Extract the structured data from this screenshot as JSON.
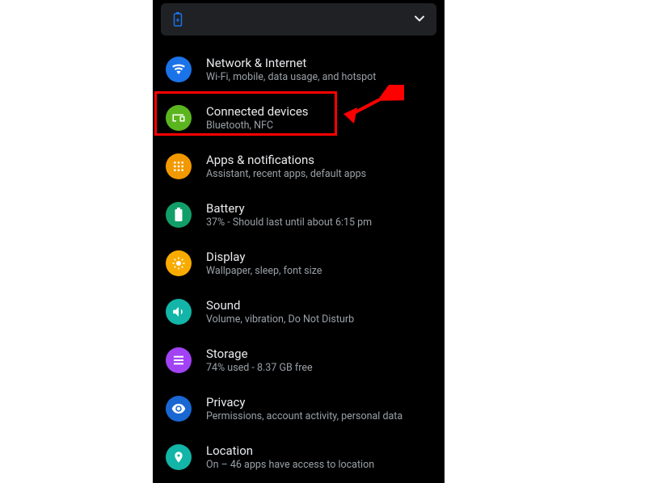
{
  "banner": {
    "icon": "battery-icon",
    "chevron": "chevron-down-icon"
  },
  "items": [
    {
      "id": "network",
      "title": "Network & Internet",
      "subtitle": "Wi-Fi, mobile, data usage, and hotspot",
      "color": "#1a73e8",
      "icon": "wifi-icon"
    },
    {
      "id": "connected",
      "title": "Connected devices",
      "subtitle": "Bluetooth, NFC",
      "color": "#5bb51f",
      "icon": "devices-icon"
    },
    {
      "id": "apps",
      "title": "Apps & notifications",
      "subtitle": "Assistant, recent apps, default apps",
      "color": "#f29900",
      "icon": "apps-icon"
    },
    {
      "id": "battery",
      "title": "Battery",
      "subtitle": "37% - Should last until about 6:15 pm",
      "color": "#129e68",
      "icon": "battery-icon"
    },
    {
      "id": "display",
      "title": "Display",
      "subtitle": "Wallpaper, sleep, font size",
      "color": "#f9ab00",
      "icon": "display-icon"
    },
    {
      "id": "sound",
      "title": "Sound",
      "subtitle": "Volume, vibration, Do Not Disturb",
      "color": "#12b5a7",
      "icon": "sound-icon"
    },
    {
      "id": "storage",
      "title": "Storage",
      "subtitle": "74% used - 8.37 GB free",
      "color": "#a142f4",
      "icon": "storage-icon"
    },
    {
      "id": "privacy",
      "title": "Privacy",
      "subtitle": "Permissions, account activity, personal data",
      "color": "#1967d2",
      "icon": "privacy-icon"
    },
    {
      "id": "location",
      "title": "Location",
      "subtitle": "On – 46 apps have access to location",
      "color": "#12b5a7",
      "icon": "location-icon"
    }
  ],
  "annotation": {
    "highlight_index": 1,
    "arrow_color": "#ff0000"
  }
}
